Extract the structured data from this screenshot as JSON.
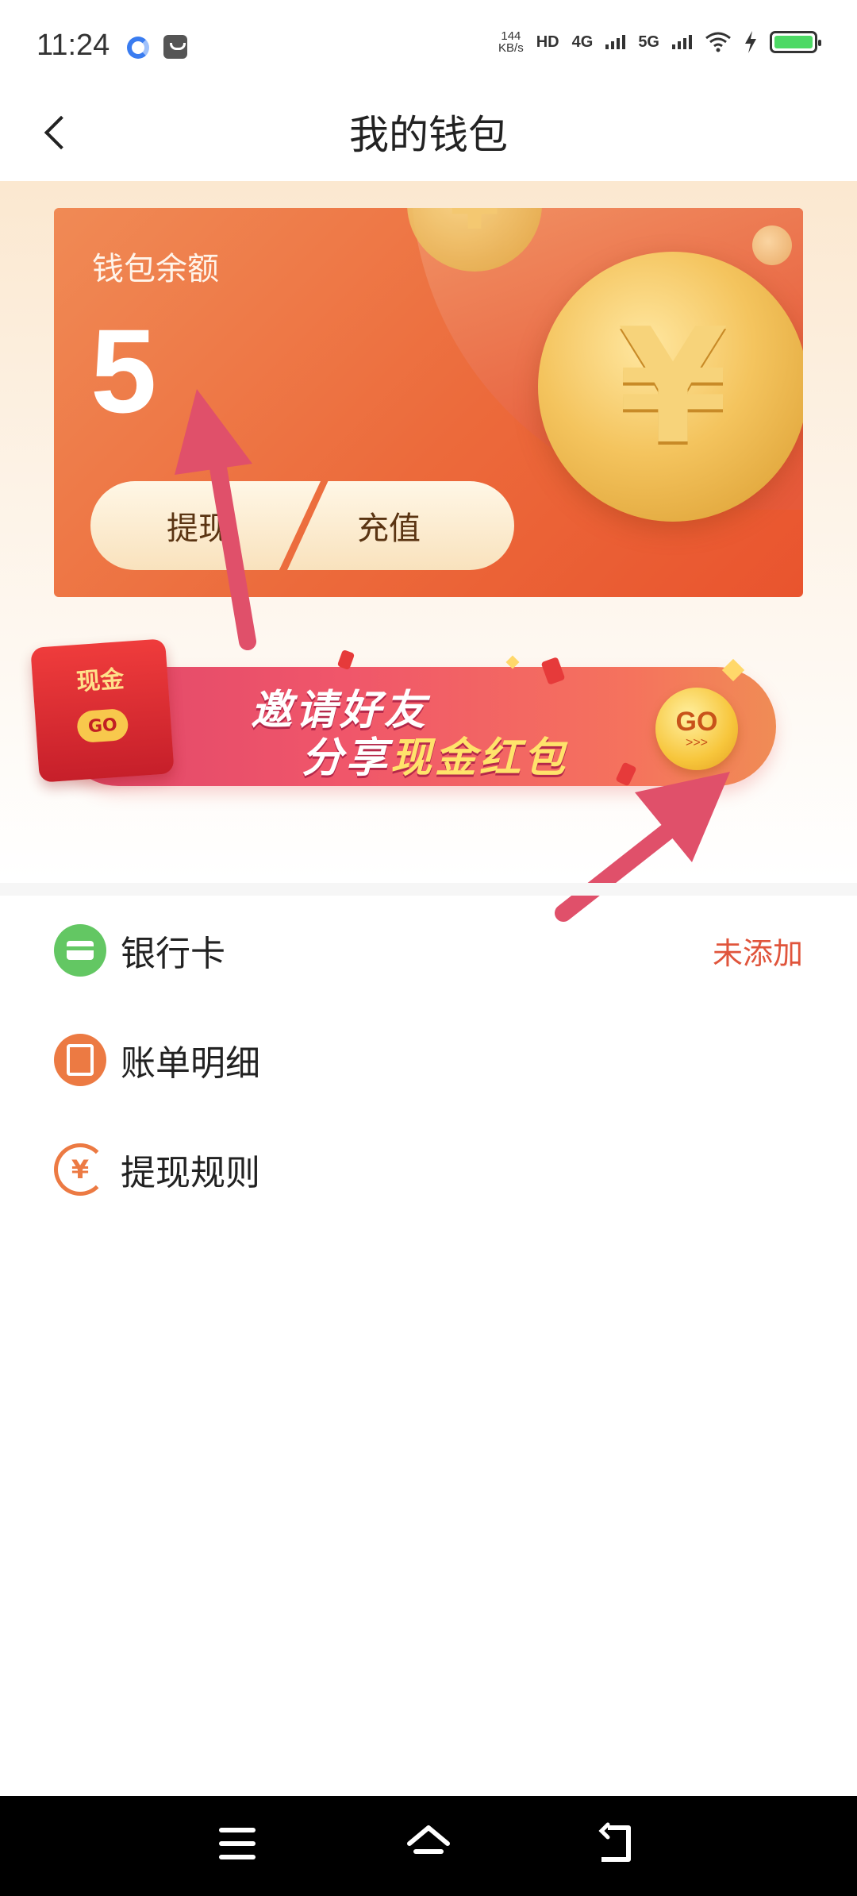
{
  "status_bar": {
    "time": "11:24",
    "net_speed_value": "144",
    "net_speed_unit": "KB/s",
    "hd_tag": "HD",
    "net_4g": "4G",
    "net_5g": "5G"
  },
  "header": {
    "title": "我的钱包"
  },
  "balance_card": {
    "label": "钱包余额",
    "value": "5",
    "withdraw_label": "提现",
    "recharge_label": "充值"
  },
  "banner": {
    "envelope_text": "现金",
    "envelope_go": "GO",
    "line1": "邀请好友",
    "line2_prefix": "分享",
    "line2_highlight": "现金红包",
    "go_label": "GO",
    "go_arrows": ">>>"
  },
  "menu": {
    "items": [
      {
        "label": "银行卡",
        "status": "未添加",
        "icon": "bank-card-icon",
        "icon_color": "#63c763"
      },
      {
        "label": "账单明细",
        "status": "",
        "icon": "bill-icon",
        "icon_color": "#ec7a43"
      },
      {
        "label": "提现规则",
        "status": "",
        "icon": "yen-rule-icon",
        "icon_color": "#ec7a43"
      }
    ]
  },
  "colors": {
    "accent": "#ec6a3b",
    "status_text": "#e0553c",
    "annotation_arrow": "#e0506a"
  }
}
